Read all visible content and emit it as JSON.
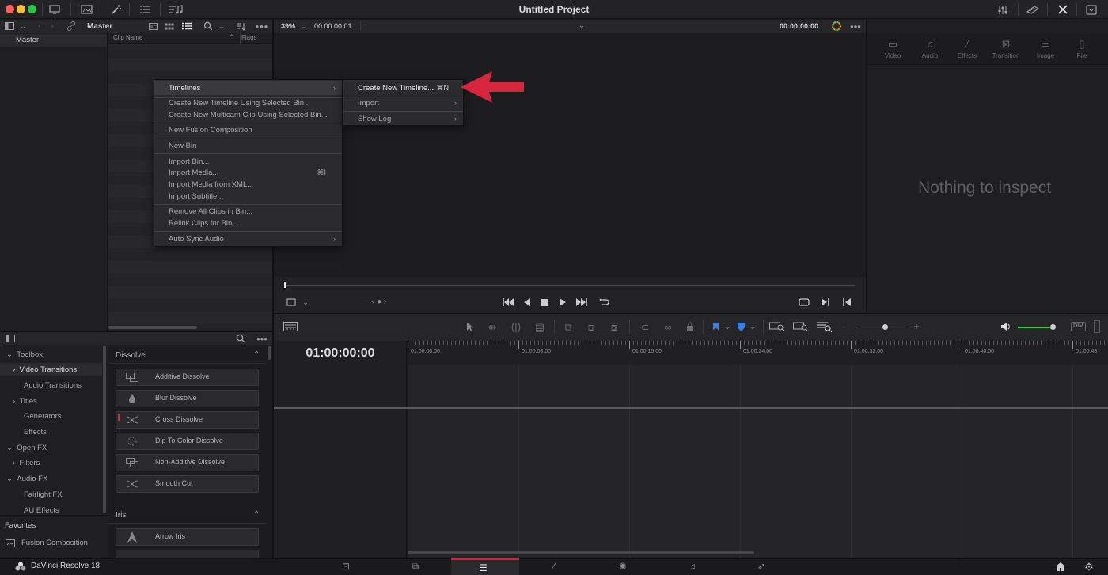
{
  "app": {
    "project_title": "Untitled Project",
    "product_name": "DaVinci Resolve 18"
  },
  "media_pool": {
    "bin_name": "Master",
    "sidebar_bin": "Master",
    "columns": [
      "Clip Name",
      "Flags"
    ]
  },
  "viewer": {
    "zoom": "39%",
    "source_timecode": "00:00:00:01",
    "record_timecode": "00:00:00:00"
  },
  "inspector": {
    "tabs": [
      "Video",
      "Audio",
      "Effects",
      "Transition",
      "Image",
      "File"
    ],
    "empty_message": "Nothing to inspect"
  },
  "context_menu": {
    "items": [
      {
        "label": "Timelines",
        "submenu": true,
        "highlighted": true
      },
      {
        "label": "Create New Timeline Using Selected Bin..."
      },
      {
        "label": "Create New Multicam Clip Using Selected Bin..."
      },
      {
        "label": "New Fusion Composition"
      },
      {
        "label": "New Bin"
      },
      {
        "label": "Import Bin..."
      },
      {
        "label": "Import Media...",
        "shortcut": "⌘I"
      },
      {
        "label": "Import Media from XML..."
      },
      {
        "label": "Import Subtitle..."
      },
      {
        "label": "Remove All Clips in Bin..."
      },
      {
        "label": "Relink Clips for Bin..."
      },
      {
        "label": "Auto Sync Audio",
        "submenu": true
      }
    ]
  },
  "submenu": {
    "items": [
      {
        "label": "Create New Timeline...",
        "shortcut": "⌘N",
        "highlighted": true
      },
      {
        "label": "Import",
        "submenu": true
      },
      {
        "label": "Show Log",
        "submenu": true
      }
    ]
  },
  "effects_library": {
    "tree": [
      {
        "label": "Toolbox",
        "expanded": true
      },
      {
        "label": "Video Transitions",
        "selected": true
      },
      {
        "label": "Audio Transitions"
      },
      {
        "label": "Titles"
      },
      {
        "label": "Generators"
      },
      {
        "label": "Effects"
      },
      {
        "label": "Open FX",
        "expanded": true
      },
      {
        "label": "Filters"
      },
      {
        "label": "Audio FX",
        "expanded": true
      },
      {
        "label": "Fairlight FX"
      },
      {
        "label": "AU Effects"
      }
    ],
    "favorites_label": "Favorites",
    "favorites": [
      "Fusion Composition"
    ],
    "sections": [
      {
        "title": "Dissolve",
        "items": [
          "Additive Dissolve",
          "Blur Dissolve",
          "Cross Dissolve",
          "Dip To Color Dissolve",
          "Non-Additive Dissolve",
          "Smooth Cut"
        ]
      },
      {
        "title": "Iris",
        "items": [
          "Arrow Iris"
        ]
      }
    ]
  },
  "timeline": {
    "timecode": "01:00:00:00",
    "ruler": [
      "01:00:00:00",
      "01:00:08:00",
      "01:00:16:00",
      "01:00:24:00",
      "01:00:32:00",
      "01:00:40:00",
      "01:00:48"
    ]
  },
  "colors": {
    "accent_arrow": "#d8263e",
    "flag_blue": "#3a7fe6",
    "volume_green": "#3bc84a",
    "active_page": "#cc2a3a"
  },
  "page_tabs": [
    "media-icon",
    "cut-icon",
    "edit-icon",
    "fusion-icon",
    "color-icon",
    "fairlight-icon",
    "deliver-icon"
  ]
}
